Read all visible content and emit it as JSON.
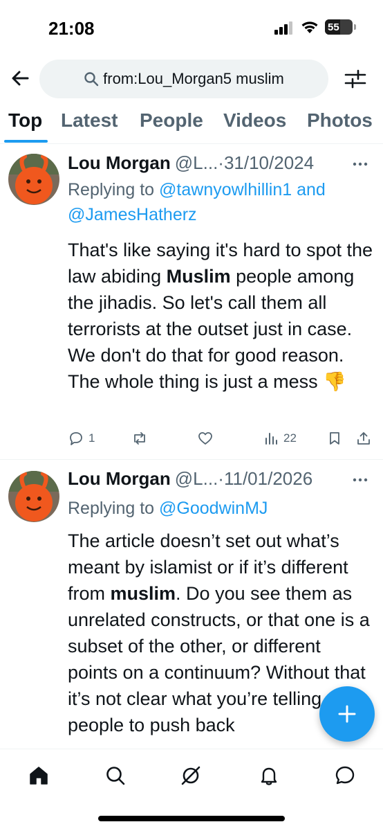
{
  "status_bar": {
    "time": "21:08",
    "battery_level": "55"
  },
  "search": {
    "query": "from:Lou_Morgan5 muslim"
  },
  "tabs": [
    {
      "label": "Top",
      "active": true
    },
    {
      "label": "Latest",
      "active": false
    },
    {
      "label": "People",
      "active": false
    },
    {
      "label": "Videos",
      "active": false
    },
    {
      "label": "Photos",
      "active": false
    }
  ],
  "tweets": [
    {
      "author_name": "Lou Morgan",
      "author_handle": "@L...",
      "date": "·31/10/2024",
      "reply_prefix": "Replying to ",
      "reply_mention_1": "@tawnyowlhillin1",
      "reply_and": " and",
      "reply_mention_2": "@JamesHatherz",
      "text_part1": "That's like saying it's hard to spot the law abiding ",
      "text_bold": "Muslim",
      "text_part2": " people among the jihadis. So let's call them all terrorists at the outset just in case. We don't do that for good reason. The whole thing is just a mess 👎",
      "reply_count": "1",
      "repost_count": "",
      "like_count": "",
      "view_count": "22"
    },
    {
      "author_name": "Lou Morgan",
      "author_handle": "@L...",
      "date": "·11/01/2026",
      "reply_prefix": "Replying to ",
      "reply_mention_1": "@GoodwinMJ",
      "text_part1": "The article doesn’t set out what’s meant by islamist or if it’s different from ",
      "text_bold": "muslim",
      "text_part2": ". Do you see them as unrelated constructs, or that one is a subset of the other, or different points on a continuum? Without that it’s not clear what you’re telling people to push back"
    }
  ],
  "colors": {
    "accent": "#1d9bf0",
    "text_primary": "#0f1419",
    "text_secondary": "#536471",
    "avatar_orange": "#f0581e"
  },
  "icons": {
    "back": "arrow-left-icon",
    "search": "search-icon",
    "filter": "filter-sliders-icon",
    "more": "more-dots-icon",
    "reply": "reply-icon",
    "repost": "repost-icon",
    "like": "heart-icon",
    "views": "views-chart-icon",
    "bookmark": "bookmark-icon",
    "share": "share-icon",
    "compose": "plus-icon",
    "nav_home": "home-icon",
    "nav_search": "search-icon",
    "nav_grok": "grok-icon",
    "nav_notifications": "bell-icon",
    "nav_messages": "message-icon"
  }
}
